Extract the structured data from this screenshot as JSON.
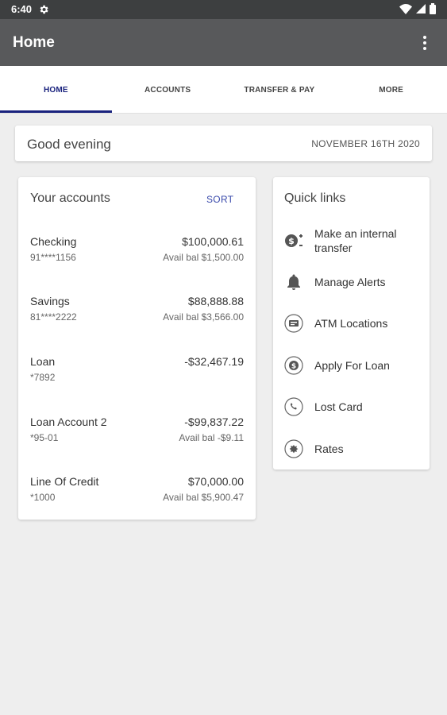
{
  "status_bar": {
    "time": "6:40"
  },
  "app_bar": {
    "title": "Home"
  },
  "tabs": [
    {
      "label": "HOME"
    },
    {
      "label": "ACCOUNTS"
    },
    {
      "label": "TRANSFER & PAY"
    },
    {
      "label": "MORE"
    }
  ],
  "greeting": {
    "text": "Good evening",
    "date": "NOVEMBER 16TH 2020"
  },
  "accounts": {
    "title": "Your accounts",
    "sort_label": "SORT",
    "items": [
      {
        "name": "Checking",
        "number": "91****1156",
        "amount": "$100,000.61",
        "avail": "Avail bal $1,500.00"
      },
      {
        "name": "Savings",
        "number": "81****2222",
        "amount": "$88,888.88",
        "avail": "Avail bal $3,566.00"
      },
      {
        "name": "Loan",
        "number": "*7892",
        "amount": "-$32,467.19",
        "avail": ""
      },
      {
        "name": "Loan Account 2",
        "number": "*95-01",
        "amount": "-$99,837.22",
        "avail": "Avail bal -$9.11"
      },
      {
        "name": "Line Of Credit",
        "number": "*1000",
        "amount": "$70,000.00",
        "avail": "Avail bal $5,900.47"
      }
    ]
  },
  "quick_links": {
    "title": "Quick links",
    "items": [
      {
        "label": "Make an internal transfer",
        "icon": "transfer-icon"
      },
      {
        "label": "Manage Alerts",
        "icon": "bell-icon"
      },
      {
        "label": "ATM Locations",
        "icon": "atm-icon"
      },
      {
        "label": "Apply For Loan",
        "icon": "loan-icon"
      },
      {
        "label": "Lost Card",
        "icon": "phone-icon"
      },
      {
        "label": "Rates",
        "icon": "rates-icon"
      }
    ]
  },
  "colors": {
    "status_bar": "#3d3f40",
    "app_bar": "#58595b",
    "accent": "#1a237e",
    "link": "#3949ab",
    "background": "#eeeeee"
  }
}
